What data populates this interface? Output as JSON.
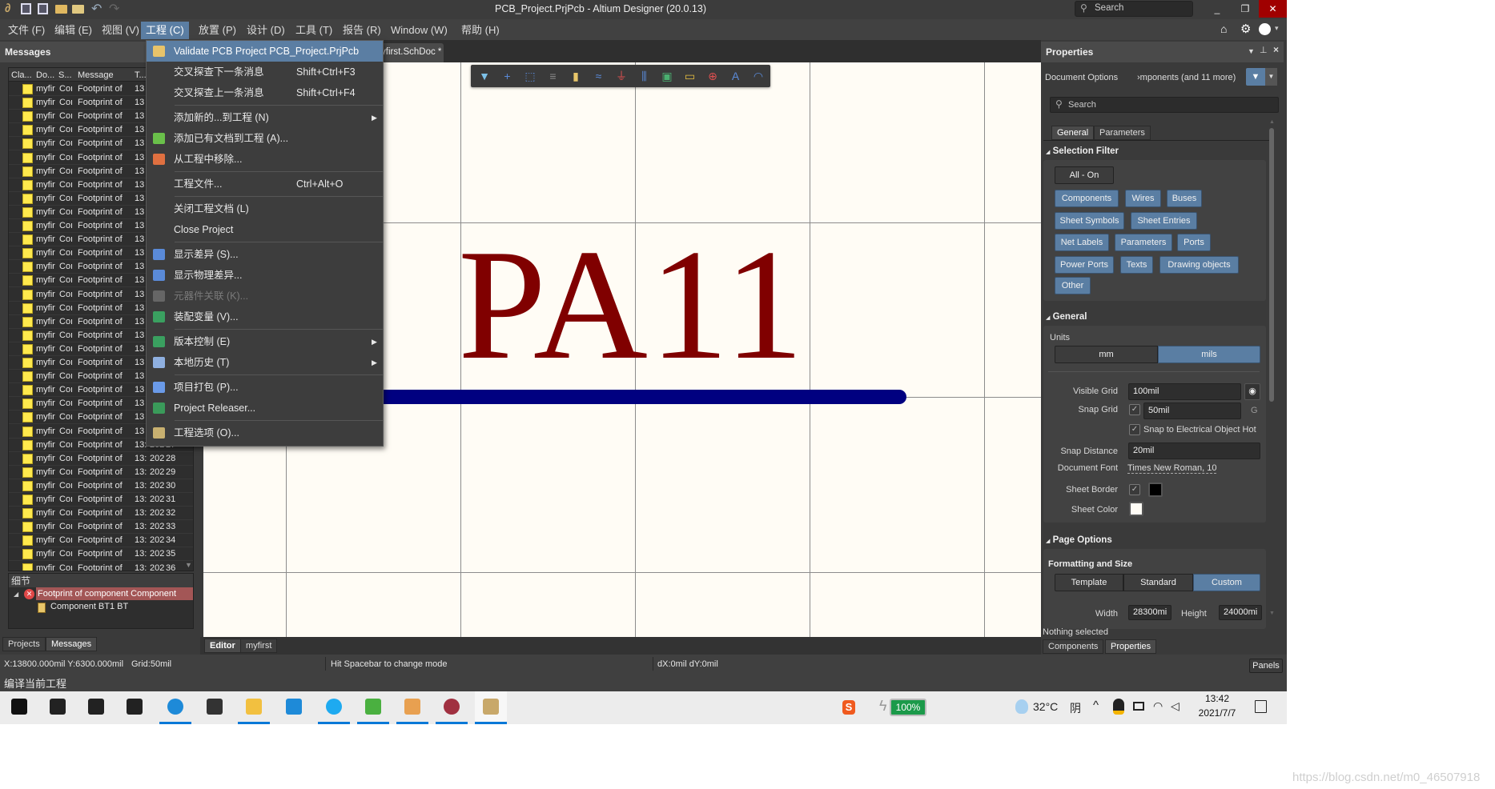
{
  "window": {
    "title": "PCB_Project.PrjPcb - Altium Designer (20.0.13)",
    "search_placeholder": "Search"
  },
  "menubar": {
    "items": [
      "文件 (F)",
      "编辑 (E)",
      "视图 (V)",
      "工程 (C)",
      "放置 (P)",
      "设计 (D)",
      "工具 (T)",
      "报告 (R)",
      "Window (W)",
      "帮助 (H)"
    ],
    "active": "工程 (C)"
  },
  "messages_panel": {
    "title": "Messages",
    "columns": [
      "Cla...",
      "Do...",
      "S...",
      "Message",
      "T..."
    ],
    "rows": [
      {
        "doc": "myfir",
        "src": "Coı",
        "msg": "Footprint of ",
        "time": "13",
        "date": "",
        "no": ""
      },
      {
        "doc": "myfir",
        "src": "Coı",
        "msg": "Footprint of ",
        "time": "13",
        "date": "",
        "no": ""
      },
      {
        "doc": "myfir",
        "src": "Coı",
        "msg": "Footprint of ",
        "time": "13",
        "date": "",
        "no": ""
      },
      {
        "doc": "myfir",
        "src": "Coı",
        "msg": "Footprint of ",
        "time": "13",
        "date": "",
        "no": ""
      },
      {
        "doc": "myfir",
        "src": "Coı",
        "msg": "Footprint of ",
        "time": "13",
        "date": "",
        "no": ""
      },
      {
        "doc": "myfir",
        "src": "Coı",
        "msg": "Footprint of ",
        "time": "13",
        "date": "",
        "no": ""
      },
      {
        "doc": "myfir",
        "src": "Coı",
        "msg": "Footprint of ",
        "time": "13",
        "date": "",
        "no": ""
      },
      {
        "doc": "myfir",
        "src": "Coı",
        "msg": "Footprint of ",
        "time": "13",
        "date": "",
        "no": ""
      },
      {
        "doc": "myfir",
        "src": "Coı",
        "msg": "Footprint of ",
        "time": "13",
        "date": "",
        "no": ""
      },
      {
        "doc": "myfir",
        "src": "Coı",
        "msg": "Footprint of ",
        "time": "13",
        "date": "",
        "no": ""
      },
      {
        "doc": "myfir",
        "src": "Coı",
        "msg": "Footprint of ",
        "time": "13",
        "date": "",
        "no": ""
      },
      {
        "doc": "myfir",
        "src": "Coı",
        "msg": "Footprint of ",
        "time": "13",
        "date": "",
        "no": ""
      },
      {
        "doc": "myfir",
        "src": "Coı",
        "msg": "Footprint of ",
        "time": "13",
        "date": "",
        "no": ""
      },
      {
        "doc": "myfir",
        "src": "Coı",
        "msg": "Footprint of ",
        "time": "13",
        "date": "",
        "no": ""
      },
      {
        "doc": "myfir",
        "src": "Coı",
        "msg": "Footprint of ",
        "time": "13",
        "date": "",
        "no": ""
      },
      {
        "doc": "myfir",
        "src": "Coı",
        "msg": "Footprint of ",
        "time": "13",
        "date": "",
        "no": ""
      },
      {
        "doc": "myfir",
        "src": "Coı",
        "msg": "Footprint of ",
        "time": "13",
        "date": "",
        "no": ""
      },
      {
        "doc": "myfir",
        "src": "Coı",
        "msg": "Footprint of ",
        "time": "13",
        "date": "",
        "no": ""
      },
      {
        "doc": "myfir",
        "src": "Coı",
        "msg": "Footprint of ",
        "time": "13",
        "date": "",
        "no": ""
      },
      {
        "doc": "myfir",
        "src": "Coı",
        "msg": "Footprint of ",
        "time": "13",
        "date": "",
        "no": ""
      },
      {
        "doc": "myfir",
        "src": "Coı",
        "msg": "Footprint of ",
        "time": "13",
        "date": "",
        "no": ""
      },
      {
        "doc": "myfir",
        "src": "Coı",
        "msg": "Footprint of ",
        "time": "13",
        "date": "",
        "no": ""
      },
      {
        "doc": "myfir",
        "src": "Coı",
        "msg": "Footprint of ",
        "time": "13",
        "date": "",
        "no": ""
      },
      {
        "doc": "myfir",
        "src": "Coı",
        "msg": "Footprint of ",
        "time": "13",
        "date": "",
        "no": ""
      },
      {
        "doc": "myfir",
        "src": "Coı",
        "msg": "Footprint of ",
        "time": "13",
        "date": "",
        "no": ""
      },
      {
        "doc": "myfir",
        "src": "Coı",
        "msg": "Footprint of ",
        "time": "13",
        "date": "",
        "no": ""
      },
      {
        "doc": "myfir",
        "src": "Coı",
        "msg": "Footprint of ",
        "time": "13:",
        "date": "202",
        "no": "27"
      },
      {
        "doc": "myfir",
        "src": "Coı",
        "msg": "Footprint of ",
        "time": "13:",
        "date": "202",
        "no": "28"
      },
      {
        "doc": "myfir",
        "src": "Coı",
        "msg": "Footprint of ",
        "time": "13:",
        "date": "202",
        "no": "29"
      },
      {
        "doc": "myfir",
        "src": "Coı",
        "msg": "Footprint of ",
        "time": "13:",
        "date": "202",
        "no": "30"
      },
      {
        "doc": "myfir",
        "src": "Coı",
        "msg": "Footprint of ",
        "time": "13:",
        "date": "202",
        "no": "31"
      },
      {
        "doc": "myfir",
        "src": "Coı",
        "msg": "Footprint of ",
        "time": "13:",
        "date": "202",
        "no": "32"
      },
      {
        "doc": "myfir",
        "src": "Coı",
        "msg": "Footprint of ",
        "time": "13:",
        "date": "202",
        "no": "33"
      },
      {
        "doc": "myfir",
        "src": "Coı",
        "msg": "Footprint of ",
        "time": "13:",
        "date": "202",
        "no": "34"
      },
      {
        "doc": "myfir",
        "src": "Coı",
        "msg": "Footprint of ",
        "time": "13:",
        "date": "202",
        "no": "35"
      },
      {
        "doc": "myfir",
        "src": "Coı",
        "msg": "Footprint of ",
        "time": "13:",
        "date": "202",
        "no": "36"
      }
    ],
    "details_title": "细节",
    "details_error": "Footprint of component Component",
    "details_child": "Component BT1 BT",
    "tabs": [
      "Projects",
      "Messages"
    ]
  },
  "project_menu": {
    "items": [
      {
        "label": "Validate PCB Project PCB_Project.PrjPcb",
        "shortcut": "",
        "icon": "validate-icon",
        "state": "highlighted"
      },
      {
        "label": "交叉探查下一条消息",
        "shortcut": "Shift+Ctrl+F3",
        "icon": "",
        "state": ""
      },
      {
        "label": "交叉探查上一条消息",
        "shortcut": "Shift+Ctrl+F4",
        "icon": "",
        "state": ""
      },
      {
        "sep": true
      },
      {
        "label": "添加新的...到工程 (N)",
        "shortcut": "",
        "icon": "",
        "state": "",
        "submenu": true
      },
      {
        "label": "添加已有文档到工程 (A)...",
        "shortcut": "",
        "icon": "add-document-icon",
        "state": ""
      },
      {
        "label": "从工程中移除...",
        "shortcut": "",
        "icon": "remove-document-icon",
        "state": ""
      },
      {
        "sep": true
      },
      {
        "label": "工程文件...",
        "shortcut": "Ctrl+Alt+O",
        "icon": "",
        "state": ""
      },
      {
        "sep": true
      },
      {
        "label": "关闭工程文档 (L)",
        "shortcut": "",
        "icon": "",
        "state": ""
      },
      {
        "label": "Close Project",
        "shortcut": "",
        "icon": "",
        "state": ""
      },
      {
        "sep": true
      },
      {
        "label": "显示差异 (S)...",
        "shortcut": "",
        "icon": "show-differences-icon",
        "state": ""
      },
      {
        "label": "显示物理差异...",
        "shortcut": "",
        "icon": "show-physical-differences-icon",
        "state": ""
      },
      {
        "label": "元器件关联 (K)...",
        "shortcut": "",
        "icon": "component-links-icon",
        "state": "disabled"
      },
      {
        "label": "装配变量 (V)...",
        "shortcut": "",
        "icon": "variants-icon",
        "state": ""
      },
      {
        "sep": true
      },
      {
        "label": "版本控制 (E)",
        "shortcut": "",
        "icon": "version-control-icon",
        "state": "",
        "submenu": true
      },
      {
        "label": "本地历史 (T)",
        "shortcut": "",
        "icon": "local-history-icon",
        "state": "",
        "submenu": true
      },
      {
        "sep": true
      },
      {
        "label": "项目打包 (P)...",
        "shortcut": "",
        "icon": "project-packager-icon",
        "state": ""
      },
      {
        "label": "Project Releaser...",
        "shortcut": "",
        "icon": "project-releaser-icon",
        "state": ""
      },
      {
        "sep": true
      },
      {
        "label": "工程选项 (O)...",
        "shortcut": "",
        "icon": "project-options-icon",
        "state": ""
      }
    ]
  },
  "editor": {
    "doc_tab": "yfirst.SchDoc *",
    "canvas_text": "PA11",
    "canvas_text_color": "#800000",
    "wire_color": "#000080",
    "sheet_color": "#fffcf5",
    "toolbar_icons": [
      "filter-icon",
      "cross-probe-icon",
      "select-area-icon",
      "align-icon",
      "part-icon",
      "harness-icon",
      "gnd-power-port-icon",
      "bus-entry-icon",
      "sheet-symbol-icon",
      "port-icon",
      "no-erc-icon",
      "text-icon",
      "arc-icon"
    ],
    "bottom_tabs": [
      "Editor",
      "myfirst"
    ]
  },
  "properties": {
    "title": "Properties",
    "doc_options": "Document Options",
    "filter_summary": "›mponents (and 11 more)",
    "search_placeholder": "Search",
    "tabs": [
      "General",
      "Parameters"
    ],
    "selection_filter": {
      "title": "Selection Filter",
      "all_on": "All - On",
      "buttons": [
        "Components",
        "Wires",
        "Buses",
        "Sheet Symbols",
        "Sheet Entries",
        "Net Labels",
        "Parameters",
        "Ports",
        "Power Ports",
        "Texts",
        "Drawing objects",
        "Other"
      ]
    },
    "general": {
      "title": "General",
      "units_label": "Units",
      "units": [
        "mm",
        "mils"
      ],
      "units_selected": "mils",
      "visible_grid_label": "Visible Grid",
      "visible_grid": "100mil",
      "snap_grid_label": "Snap Grid",
      "snap_grid": "50mil",
      "snap_grid_checked": true,
      "snap_grid_hotkey": "G",
      "snap_electrical": "Snap to Electrical Object Hot",
      "snap_electrical_checked": true,
      "snap_distance_label": "Snap Distance",
      "snap_distance": "20mil",
      "document_font_label": "Document Font",
      "document_font": "Times New Roman, 10",
      "sheet_border_label": "Sheet Border",
      "sheet_border_checked": true,
      "sheet_border_color": "#000000",
      "sheet_color_label": "Sheet Color",
      "sheet_color": "#fffcf5"
    },
    "page_options": {
      "title": "Page Options",
      "formatting_title": "Formatting and Size",
      "modes": [
        "Template",
        "Standard",
        "Custom"
      ],
      "mode_selected": "Custom",
      "width_label": "Width",
      "width": "28300mi",
      "height_label": "Height",
      "height": "24000mi"
    },
    "status": "Nothing selected",
    "bottom_tabs": [
      "Components",
      "Properties"
    ]
  },
  "statusbar": {
    "coords": "X:13800.000mil Y:6300.000mil",
    "grid": "Grid:50mil",
    "hint": "Hit Spacebar to change mode",
    "delta": "dX:0mil dY:0mil",
    "panels_button": "Panels",
    "message": "编译当前工程"
  },
  "taskbar": {
    "battery": "100%",
    "temperature": "32°C",
    "weather": "阴",
    "time": "13:42",
    "date": "2021/7/7"
  },
  "watermark": "https://blog.csdn.net/m0_46507918"
}
